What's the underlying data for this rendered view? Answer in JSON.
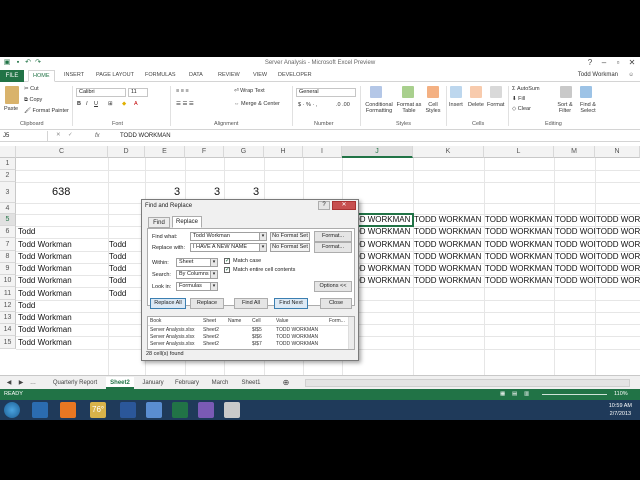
{
  "window": {
    "title": "Server Analysis - Microsoft Excel Preview",
    "user": "Todd Workman"
  },
  "ribbon_tabs": [
    "FILE",
    "HOME",
    "INSERT",
    "PAGE LAYOUT",
    "FORMULAS",
    "DATA",
    "REVIEW",
    "VIEW",
    "DEVELOPER"
  ],
  "ribbon": {
    "clipboard": {
      "paste": "Paste",
      "cut": "Cut",
      "copy": "Copy",
      "format_painter": "Format Painter",
      "label": "Clipboard"
    },
    "font": {
      "name": "Calibri",
      "size": "11",
      "label": "Font"
    },
    "alignment": {
      "wrap": "Wrap Text",
      "merge": "Merge & Center",
      "label": "Alignment"
    },
    "number": {
      "format": "General",
      "label": "Number"
    },
    "styles": {
      "cond": "Conditional Formatting",
      "fmt_table": "Format as Table",
      "cell_styles": "Cell Styles",
      "label": "Styles"
    },
    "cells": {
      "insert": "Insert",
      "delete": "Delete",
      "format": "Format",
      "label": "Cells"
    },
    "editing": {
      "autosum": "AutoSum",
      "fill": "Fill",
      "clear": "Clear",
      "sort": "Sort & Filter",
      "find": "Find & Select",
      "label": "Editing"
    }
  },
  "formula_bar": {
    "name_box": "J5",
    "fx": "fx",
    "content": "TODD WORKMAN"
  },
  "columns": [
    {
      "id": "C",
      "label": "C"
    },
    {
      "id": "D",
      "label": "D"
    },
    {
      "id": "E",
      "label": "E"
    },
    {
      "id": "F",
      "label": "F"
    },
    {
      "id": "G",
      "label": "G"
    },
    {
      "id": "H",
      "label": "H"
    },
    {
      "id": "I",
      "label": "I"
    },
    {
      "id": "J",
      "label": "J"
    },
    {
      "id": "K",
      "label": "K"
    },
    {
      "id": "L",
      "label": "L"
    },
    {
      "id": "M",
      "label": "M"
    },
    {
      "id": "N",
      "label": "N"
    }
  ],
  "rows": [
    "1",
    "2",
    "3",
    "4",
    "5",
    "6",
    "7",
    "8",
    "9",
    "10",
    "11",
    "12",
    "13",
    "14",
    "15"
  ],
  "selected": {
    "column": "J",
    "row": "5"
  },
  "cells": {
    "C3": "638",
    "E3": "3",
    "F3": "3",
    "G3": "3",
    "A6": "Todd",
    "A7": "Todd Workman",
    "D7": "Todd",
    "A8": "Todd Workman",
    "D8": "Todd",
    "A9": "Todd Workman",
    "D9": "Todd",
    "A10": "Todd Workman",
    "D10": "Todd",
    "A11": "Todd Workman",
    "D11": "Todd",
    "A12": "Todd",
    "A13": "Todd Workman",
    "A14": "Todd Workman",
    "A15": "Todd Workman",
    "J5": "TODD WORKMAN",
    "K5": "TODD WORKMAN",
    "L5": "TODD WORKMAN",
    "M5": "TODD WORKMAN",
    "N5": "TODD WORKMAN",
    "J6": "TODD WORKMAN",
    "K6": "TODD WORKMAN",
    "L6": "TODD WORKMAN",
    "M6": "TODD WORKMAN",
    "N6": "TODD WORKMAN",
    "J7": "TODD WORKMAN",
    "K7": "TODD WORKMAN",
    "L7": "TODD WORKMAN",
    "M7": "TODD WORKMAN",
    "N7": "TODD WORKMAN",
    "J8": "TODD WORKMAN",
    "K8": "TODD WORKMAN",
    "L8": "TODD WORKMAN",
    "M8": "TODD WORKMAN",
    "N8": "TODD WORKMAN",
    "J9": "TODD WORKMAN",
    "K9": "TODD WORKMAN",
    "L9": "TODD WORKMAN",
    "M9": "TODD WORKMAN",
    "N9": "TODD WORKMAN",
    "J10": "TODD WORKMAN",
    "K10": "TODD WORKMAN",
    "L10": "TODD WORKMAN",
    "M10": "TODD WORKMAN",
    "N10": "TODD WORKMAN"
  },
  "sheets": [
    "Quarterly Report",
    "Sheet2",
    "January",
    "February",
    "March",
    "Sheet1"
  ],
  "active_sheet": "Sheet2",
  "status": {
    "ready": "READY",
    "zoom": "110%"
  },
  "taskbar": {
    "weather": "76°",
    "time": "10:59 AM",
    "date": "2/7/2013"
  },
  "dialog": {
    "title": "Find and Replace",
    "tabs": [
      "Find",
      "Replace"
    ],
    "find_label": "Find what:",
    "find_value": "Todd Workman",
    "find_format": "No Format Set",
    "replace_label": "Replace with:",
    "replace_value": "I HAVE A NEW NAME",
    "replace_format": "No Format Set",
    "format_btn": "Format...",
    "within_label": "Within:",
    "within": "Sheet",
    "search_label": "Search:",
    "search": "By Columns",
    "lookin_label": "Look in:",
    "lookin": "Formulas",
    "match_case": "Match case",
    "match_entire": "Match entire cell contents",
    "options": "Options <<",
    "buttons": {
      "replace_all": "Replace All",
      "replace": "Replace",
      "find_all": "Find All",
      "find_next": "Find Next",
      "close": "Close"
    },
    "results_headers": [
      "Book",
      "Sheet",
      "Name",
      "Cell",
      "Value",
      "Form..."
    ],
    "results": [
      [
        "Server Analysis.xlsx",
        "Sheet2",
        "",
        "$I$5",
        "TODD WORKMAN"
      ],
      [
        "Server Analysis.xlsx",
        "Sheet2",
        "",
        "$I$6",
        "TODD WORKMAN"
      ],
      [
        "Server Analysis.xlsx",
        "Sheet2",
        "",
        "$I$7",
        "TODD WORKMAN"
      ]
    ],
    "found": "28 cell(s) found"
  },
  "colors": {
    "excel_green": "#217346",
    "taskbar": "#1f3a5a"
  }
}
